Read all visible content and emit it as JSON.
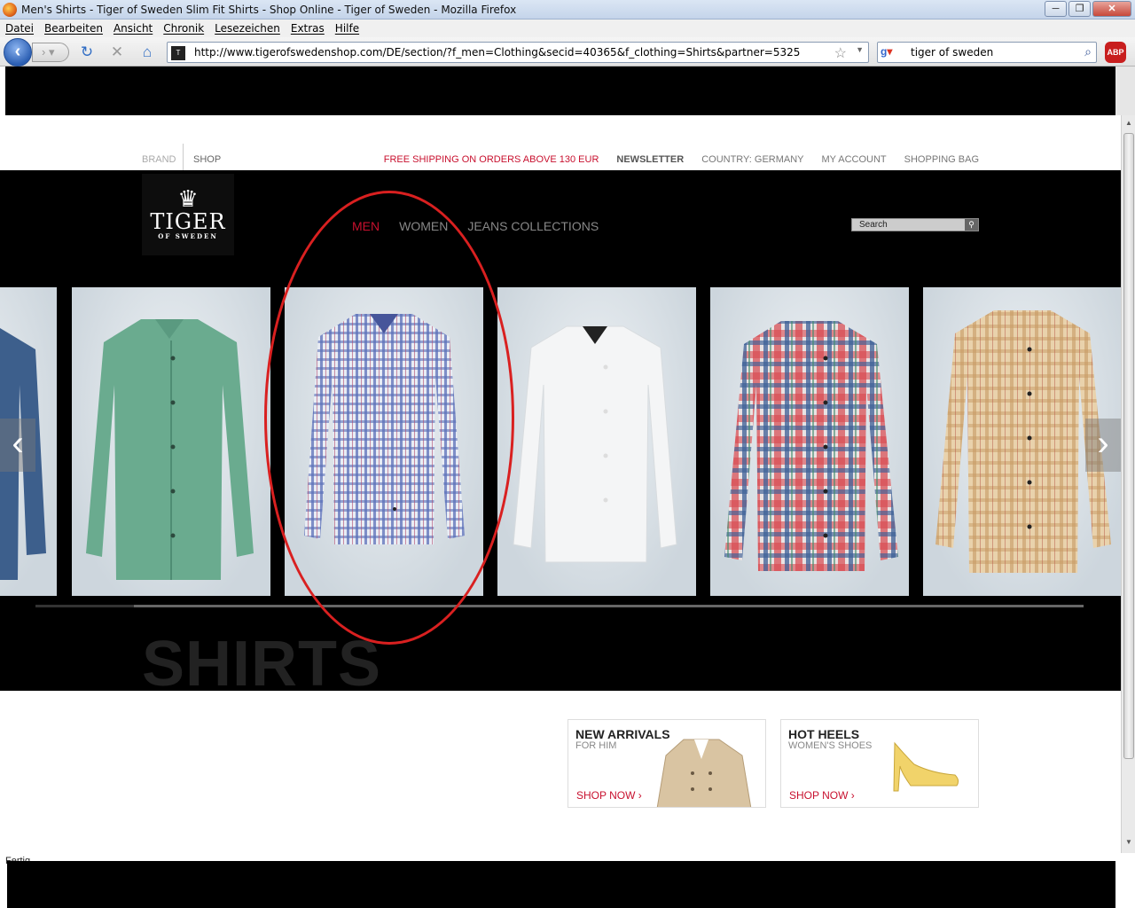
{
  "browser": {
    "window_title": "Men's Shirts - Tiger of Sweden Slim Fit Shirts - Shop Online - Tiger of Sweden - Mozilla Firefox",
    "menu": [
      "Datei",
      "Bearbeiten",
      "Ansicht",
      "Chronik",
      "Lesezeichen",
      "Extras",
      "Hilfe"
    ],
    "url": "http://www.tigerofswedenshop.com/DE/section/?f_men=Clothing&secid=40365&f_clothing=Shirts&partner=5325",
    "search_query": "tiger of sweden",
    "addon_label": "ABP",
    "status_text": "Fertig"
  },
  "site": {
    "top": {
      "brand": "BRAND",
      "shop": "SHOP",
      "free_shipping": "FREE SHIPPING ON ORDERS ABOVE 130 EUR",
      "newsletter": "NEWSLETTER",
      "country": "COUNTRY: GERMANY",
      "account": "MY ACCOUNT",
      "bag": "SHOPPING BAG"
    },
    "logo": {
      "name": "TIGER",
      "sub": "OF SWEDEN"
    },
    "nav": {
      "men": "MEN",
      "women": "WOMEN",
      "jeans": "JEANS COLLECTIONS"
    },
    "search_placeholder": "Search",
    "section_title": "SHIRTS",
    "carousel": {
      "shirts": [
        "denim",
        "green",
        "blue-check",
        "white",
        "red-blue-plaid",
        "beige-check"
      ],
      "prev_arrow": "‹",
      "next_arrow": "›",
      "progress": 0.91
    },
    "promos": [
      {
        "heading": "NEW ARRIVALS",
        "sub": "FOR HIM",
        "cta": "SHOP NOW ›"
      },
      {
        "heading": "HOT HEELS",
        "sub": "WOMEN'S SHOES",
        "cta": "SHOP NOW ›"
      }
    ]
  },
  "colors": {
    "accent_red": "#c8102e",
    "annotation_red": "#d92020"
  }
}
